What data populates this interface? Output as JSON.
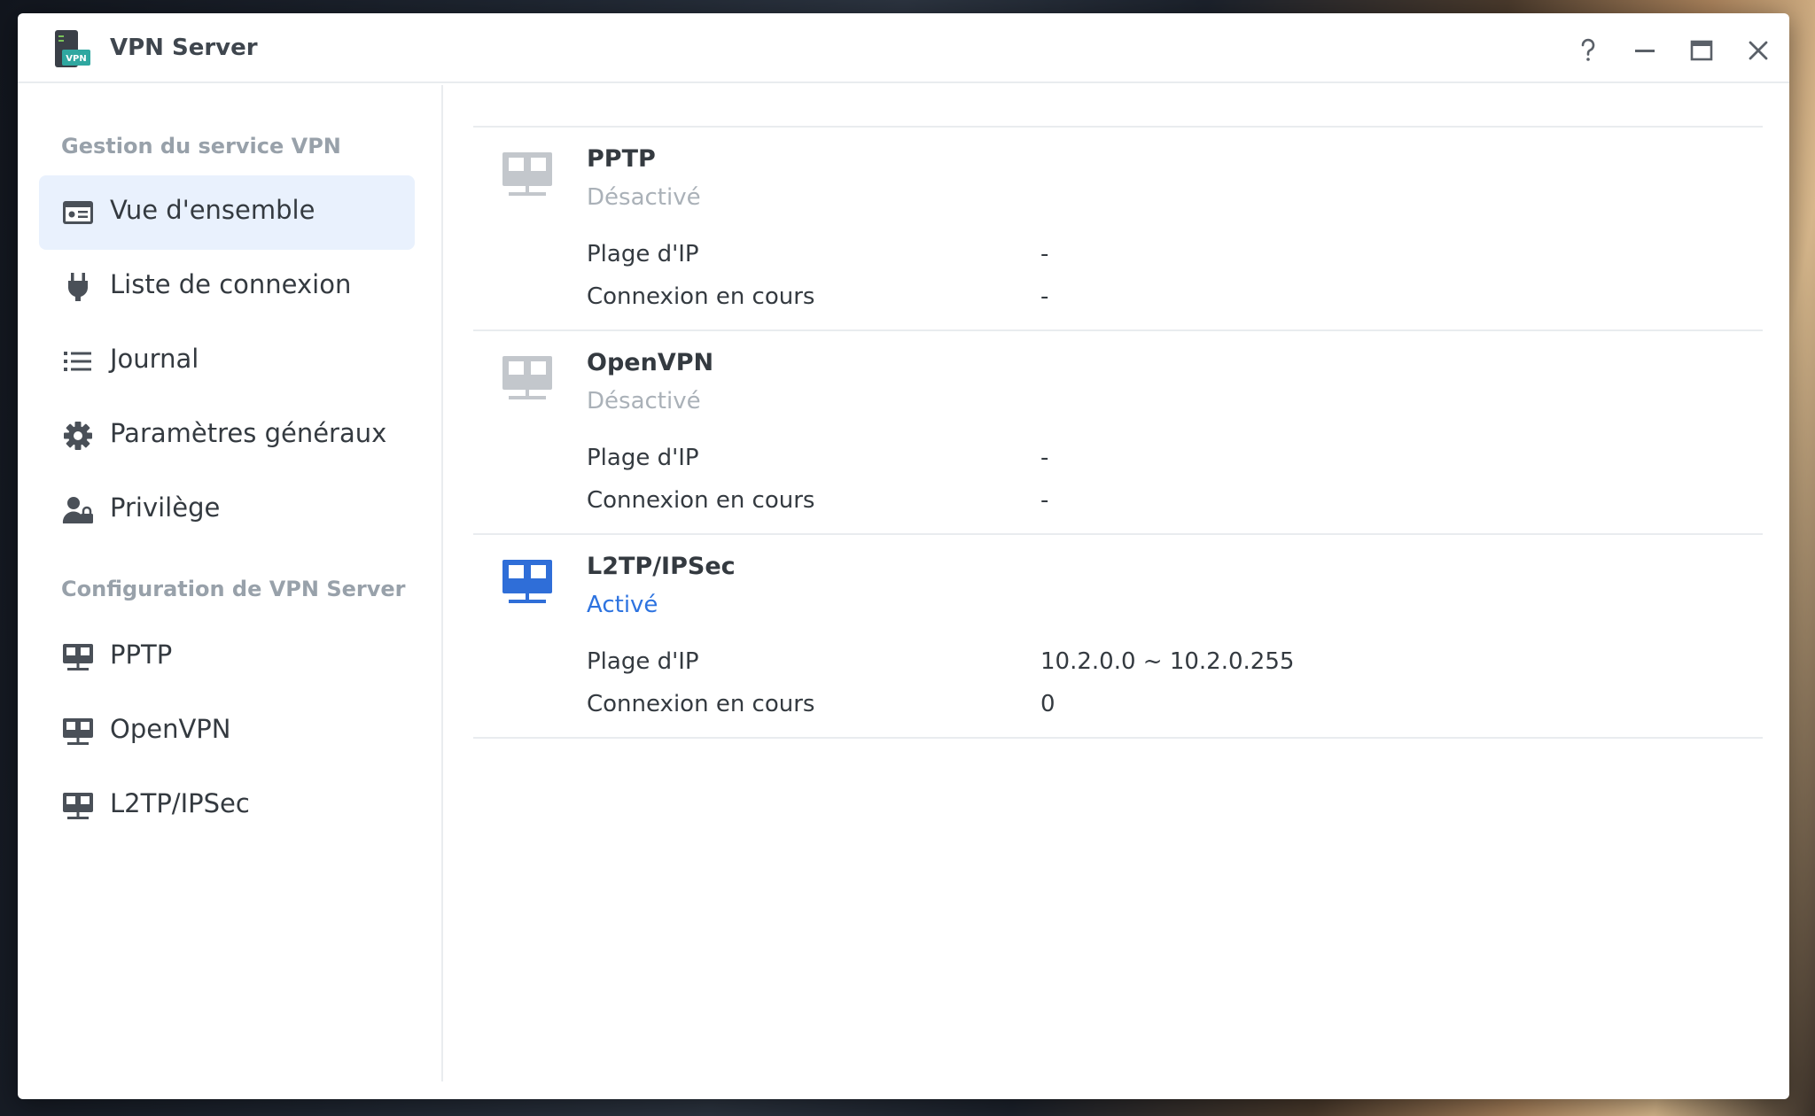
{
  "window": {
    "title": "VPN Server",
    "app_icon_badge": "VPN",
    "controls": [
      "help-icon",
      "minimize-icon",
      "maximize-icon",
      "close-icon"
    ]
  },
  "sidebar": {
    "section1_title": "Gestion du service VPN",
    "section1_items": [
      {
        "label": "Vue d'ensemble",
        "icon": "overview-card-icon",
        "active": true
      },
      {
        "label": "Liste de connexion",
        "icon": "plug-icon",
        "active": false
      },
      {
        "label": "Journal",
        "icon": "list-icon",
        "active": false
      },
      {
        "label": "Paramètres généraux",
        "icon": "gear-icon",
        "active": false
      },
      {
        "label": "Privilège",
        "icon": "user-lock-icon",
        "active": false
      }
    ],
    "section2_title": "Configuration de VPN Server",
    "section2_items": [
      {
        "label": "PPTP",
        "icon": "network-icon"
      },
      {
        "label": "OpenVPN",
        "icon": "network-icon"
      },
      {
        "label": "L2TP/IPSec",
        "icon": "network-icon"
      }
    ]
  },
  "services": [
    {
      "name": "PPTP",
      "status": "Désactivé",
      "enabled": false,
      "ip_range_label": "Plage d'IP",
      "ip_range": "-",
      "connections_label": "Connexion en cours",
      "connections": "-"
    },
    {
      "name": "OpenVPN",
      "status": "Désactivé",
      "enabled": false,
      "ip_range_label": "Plage d'IP",
      "ip_range": "-",
      "connections_label": "Connexion en cours",
      "connections": "-"
    },
    {
      "name": "L2TP/IPSec",
      "status": "Activé",
      "enabled": true,
      "ip_range_label": "Plage d'IP",
      "ip_range": "10.2.0.0 ~ 10.2.0.255",
      "connections_label": "Connexion en cours",
      "connections": "0"
    }
  ],
  "colors": {
    "accent": "#2d73e0",
    "disabled_icon": "#c3c7cc",
    "enabled_icon": "#2f6ed8",
    "nav_icon": "#4a5058",
    "active_nav_bg": "#e9f1fd"
  }
}
